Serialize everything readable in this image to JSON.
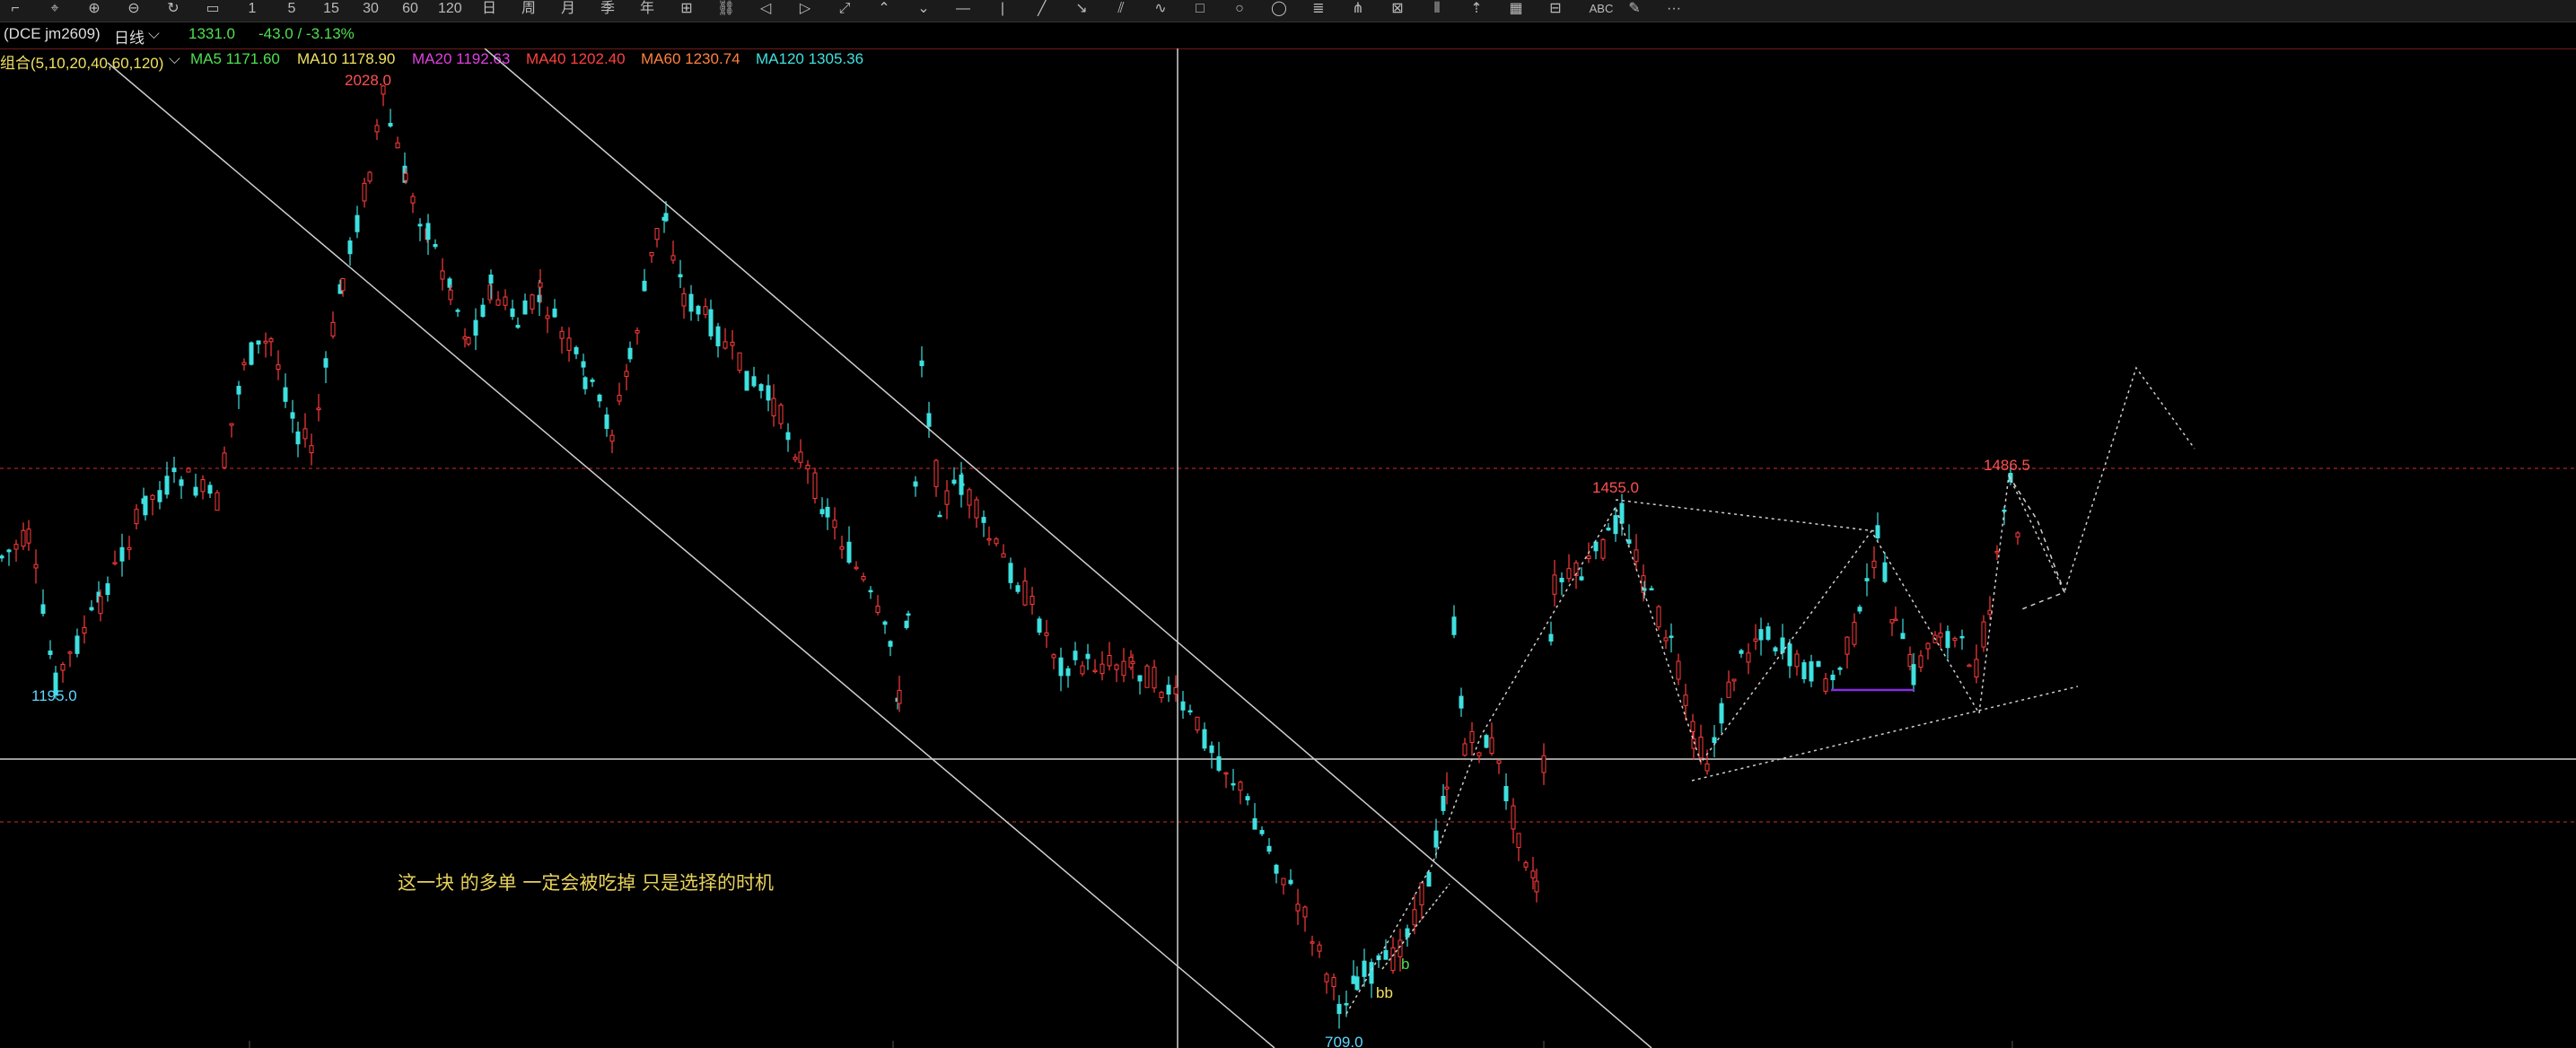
{
  "toolbar": {
    "icons": [
      "cursor-icon",
      "crosshair-icon",
      "zoom-in-icon",
      "zoom-out-icon",
      "refresh-icon",
      "select-icon",
      "period-1m-icon",
      "period-5m-icon",
      "period-15m-icon",
      "period-30m-icon",
      "period-60m-icon",
      "period-120m-icon",
      "period-day-icon",
      "period-week-icon",
      "period-month-icon",
      "period-quarter-icon",
      "period-year-icon",
      "overlay-icon",
      "link-icon",
      "arrow-left-icon",
      "arrow-right-icon",
      "zoom-fit-icon",
      "collapse-icon",
      "more-tools-icon",
      "horizontal-line-icon",
      "vertical-line-icon",
      "trend-line-icon",
      "ray-icon",
      "parallel-line-icon",
      "wave-icon",
      "rectangle-icon",
      "circle-icon",
      "ellipse-icon",
      "fib-icon",
      "pitchfork-icon",
      "gann-icon",
      "vertical-bars-icon",
      "arrow-up-icon",
      "grid-icon",
      "ruler-icon",
      "text-icon",
      "eraser-icon",
      "more-icon"
    ],
    "period_labels": [
      "日",
      "周",
      "月",
      "季",
      "年"
    ],
    "text_tool": "ABC",
    "more": "···"
  },
  "symbol": {
    "name": "(DCE jm2609)",
    "period": "日线",
    "price": "1331.0",
    "change": "-43.0 / -3.13%"
  },
  "ma_bar": {
    "group": "组合(5,10,20,40,60,120)",
    "items": [
      {
        "label": "MA5 1171.60",
        "color": "#4ee04e"
      },
      {
        "label": "MA10 1178.90",
        "color": "#f0e060"
      },
      {
        "label": "MA20 1192.63",
        "color": "#e040e0"
      },
      {
        "label": "MA40 1202.40",
        "color": "#ff4040"
      },
      {
        "label": "MA60 1230.74",
        "color": "#ff8040"
      },
      {
        "label": "MA120 1305.36",
        "color": "#40e0e0"
      }
    ]
  },
  "chart_labels": {
    "high_2028": "2028.0",
    "low_1195": "1195.0",
    "low_709": "709.0",
    "high_1455": "1455.0",
    "high_1486": "1486.5",
    "bb": "bb",
    "b": "b",
    "annotation": "这一块  的多单  一定会被吃掉  只是选择的时机"
  },
  "colors": {
    "up": "#ff3b3b",
    "down": "#3ee0e0",
    "drawing": "#cfcfcf",
    "annotation": "#e8d25a",
    "high_label": "#ff5050",
    "low_label": "#5ed8ff",
    "purple_line": "#8a2be2"
  }
}
